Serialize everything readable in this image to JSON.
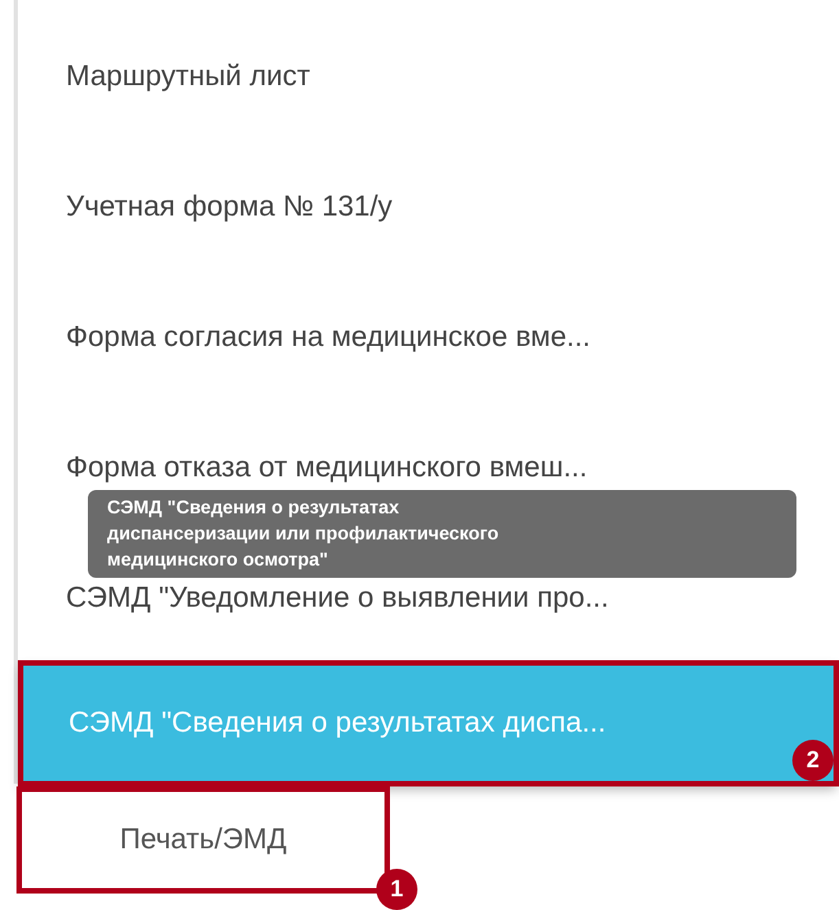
{
  "menu": {
    "items": [
      {
        "label": "Маршрутный лист",
        "selected": false,
        "highlighted": false
      },
      {
        "label": "Учетная форма № 131/у",
        "selected": false,
        "highlighted": false
      },
      {
        "label": "Форма согласия на медицинское вме...",
        "selected": false,
        "highlighted": false
      },
      {
        "label": "Форма отказа от медицинского вмеш...",
        "selected": false,
        "highlighted": false
      },
      {
        "label": "СЭМД \"Уведомление о выявлении про...",
        "selected": false,
        "highlighted": false
      },
      {
        "label": "СЭМД \"Сведения о результатах диспа...",
        "selected": true,
        "highlighted": true,
        "badge": "2"
      }
    ]
  },
  "tooltip": {
    "text": "СЭМД \"Сведения о результатах диспансеризации или профилактического медицинского осмотра\""
  },
  "print_button": {
    "label": "Печать/ЭМД",
    "highlighted": true,
    "badge": "1"
  }
}
